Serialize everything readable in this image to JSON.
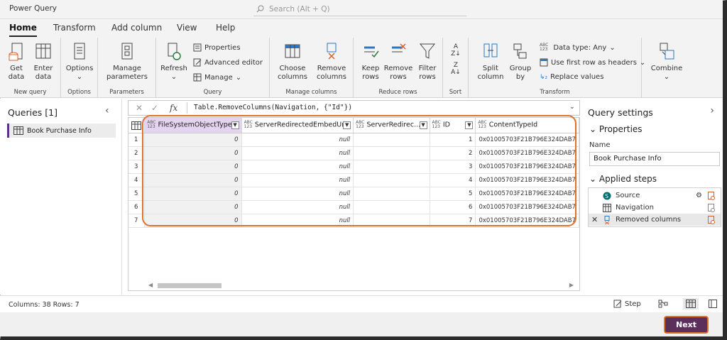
{
  "app": {
    "title": "Power Query"
  },
  "search": {
    "placeholder": "Search (Alt + Q)"
  },
  "menu": {
    "tabs": [
      "Home",
      "Transform",
      "Add column",
      "View",
      "Help"
    ],
    "active": "Home"
  },
  "ribbon": {
    "new_query": {
      "label": "New query",
      "get_data": "Get\ndata",
      "enter_data": "Enter\ndata"
    },
    "options": {
      "label": "Options",
      "options_btn": "Options"
    },
    "parameters": {
      "label": "Parameters",
      "manage_params": "Manage\nparameters"
    },
    "query": {
      "label": "Query",
      "refresh": "Refresh",
      "properties": "Properties",
      "advanced_editor": "Advanced editor",
      "manage": "Manage"
    },
    "manage_columns": {
      "label": "Manage columns",
      "choose": "Choose\ncolumns",
      "remove": "Remove\ncolumns"
    },
    "reduce_rows": {
      "label": "Reduce rows",
      "keep": "Keep\nrows",
      "remove": "Remove\nrows",
      "filter": "Filter\nrows"
    },
    "sort": {
      "label": "Sort"
    },
    "transform": {
      "label": "Transform",
      "split": "Split\ncolumn",
      "group": "Group\nby",
      "data_type": "Data type: Any",
      "first_row": "Use first row as headers",
      "replace": "Replace values"
    },
    "combine": {
      "combine": "Combine"
    }
  },
  "queries": {
    "title": "Queries [1]",
    "items": [
      "Book Purchase Info"
    ]
  },
  "formula": {
    "text": "Table.RemoveColumns(Navigation, {\"Id\"})"
  },
  "table": {
    "columns": [
      "FileSystemObjectType",
      "ServerRedirectedEmbedUri",
      "ServerRedirec...",
      "ID",
      "ContentTypeId"
    ],
    "rows": [
      [
        "1",
        "0",
        "null",
        "",
        "1",
        "0x01005703F21B796E324DAB7"
      ],
      [
        "2",
        "0",
        "null",
        "",
        "2",
        "0x01005703F21B796E324DAB7"
      ],
      [
        "3",
        "0",
        "null",
        "",
        "3",
        "0x01005703F21B796E324DAB7"
      ],
      [
        "4",
        "0",
        "null",
        "",
        "4",
        "0x01005703F21B796E324DAB7"
      ],
      [
        "5",
        "0",
        "null",
        "",
        "5",
        "0x01005703F21B796E324DAB7"
      ],
      [
        "6",
        "0",
        "null",
        "",
        "6",
        "0x01005703F21B796E324DAB7"
      ],
      [
        "7",
        "0",
        "null",
        "",
        "7",
        "0x01005703F21B796E324DAB7"
      ]
    ]
  },
  "settings": {
    "title": "Query settings",
    "properties": "Properties",
    "name_label": "Name",
    "name_value": "Book Purchase Info",
    "applied_steps": "Applied steps",
    "steps": [
      "Source",
      "Navigation",
      "Removed columns"
    ]
  },
  "status": {
    "text": "Columns: 38   Rows: 7",
    "step": "Step"
  },
  "footer": {
    "next": "Next"
  },
  "colors": {
    "accent": "#5b2e5b",
    "highlight": "#e0712b",
    "selected_header": "#e4d4ef"
  }
}
